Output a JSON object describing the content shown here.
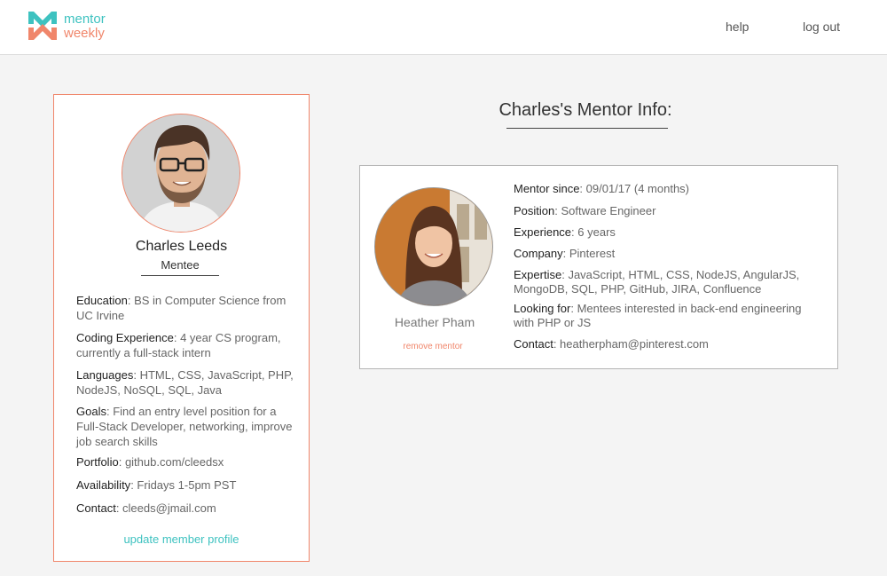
{
  "brand": {
    "line1": "mentor",
    "line2": "weekly",
    "accent_teal": "#3ec2c0",
    "accent_coral": "#f0866b"
  },
  "nav": {
    "help": "help",
    "logout": "log out"
  },
  "mentee": {
    "name": "Charles Leeds",
    "role": "Mentee",
    "fields": [
      {
        "label": "Education",
        "value": "BS in Computer Science from UC Irvine"
      },
      {
        "label": "Coding Experience",
        "value": "4 year CS program, currently a full-stack intern"
      },
      {
        "label": "Languages",
        "value": "HTML, CSS, JavaScript, PHP, NodeJS, NoSQL, SQL, Java"
      },
      {
        "label": "Goals",
        "value": "Find an entry level position for a Full-Stack Developer, networking, improve job search skills"
      },
      {
        "label": "Portfolio",
        "value": "github.com/cleedsx"
      },
      {
        "label": "Availability",
        "value": "Fridays 1-5pm PST"
      },
      {
        "label": "Contact",
        "value": "cleeds@jmail.com"
      }
    ],
    "update_link": "update member profile"
  },
  "section_title": "Charles's Mentor Info:",
  "mentor": {
    "name": "Heather Pham",
    "remove_link": "remove mentor",
    "fields": [
      {
        "label": "Mentor since",
        "value": "09/01/17  (4 months)"
      },
      {
        "label": "Position",
        "value": "Software Engineer"
      },
      {
        "label": "Experience",
        "value": "6 years"
      },
      {
        "label": "Company",
        "value": "Pinterest"
      },
      {
        "label": "Expertise",
        "value": "JavaScript, HTML, CSS, NodeJS, AngularJS, MongoDB, SQL, PHP, GitHub, JIRA, Confluence"
      },
      {
        "label": "Looking for",
        "value": "Mentees interested in back-end engineering with PHP or JS"
      },
      {
        "label": "Contact",
        "value": "heatherpham@pinterest.com"
      }
    ]
  }
}
